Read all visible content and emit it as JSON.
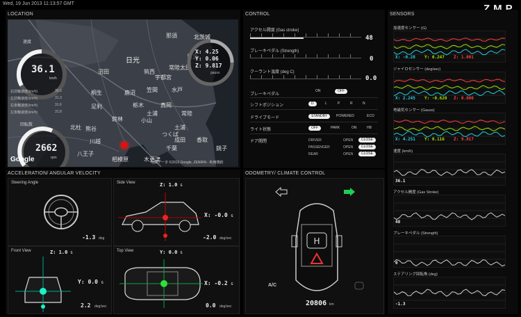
{
  "timestamp": "Wed, 19 Jun 2013 11:13:57 GMT",
  "brand": "ZMP",
  "location": {
    "title": "LOCATION",
    "map_labels": [
      "北茨城",
      "日光",
      "那須",
      "鹿沼",
      "宇都宮",
      "真岡",
      "栃木",
      "小山",
      "足利",
      "桐生",
      "館林",
      "熊谷",
      "つくば",
      "土浦",
      "川越",
      "八王子",
      "相模原",
      "千葉",
      "成田",
      "銚子",
      "香取",
      "木更津",
      "筑西",
      "常陸太田",
      "水戸",
      "笠間",
      "北杜",
      "沼田",
      "土浦",
      "常陸",
      "日立"
    ],
    "copyright": "地図データ ©2013 Google, ZENRIN - 利用規約",
    "google": "Google",
    "speed_label": "速度",
    "speed_value": "36.1",
    "speed_unit": "km/h",
    "wheel_speeds": [
      {
        "label": "右前輪速度(km/h)",
        "value": "36.5"
      },
      {
        "label": "左前輪速度(km/h)",
        "value": "31.3"
      },
      {
        "label": "右後輪速度(km/h)",
        "value": "31.6"
      },
      {
        "label": "左後輪速度(km/h)",
        "value": "31.8"
      }
    ],
    "rpm_label": "回転数",
    "rpm_value": "2662",
    "rpm_unit": "rpm",
    "compass": {
      "x": "4.25",
      "y": "0.06",
      "z": "9.817",
      "unit": "gauss"
    }
  },
  "control": {
    "title": "CONTROL",
    "sliders": [
      {
        "label": "アクセル開度 (Gas stroke)",
        "value": "48",
        "fill": 0.48
      },
      {
        "label": "ブレーキペダル (Strength)",
        "value": "0",
        "fill": 0.0
      },
      {
        "label": "クーラント温度 (deg C)",
        "value": "0.0",
        "fill": 0.0
      }
    ],
    "brake": {
      "label": "ブレーキペダル",
      "on": "ON",
      "off": "OFF"
    },
    "shift": {
      "label": "シフトポジション",
      "options": [
        "D",
        "L",
        "P",
        "R",
        "N"
      ]
    },
    "drive": {
      "label": "ドライブモード",
      "options": [
        "STANDBY",
        "POWERED",
        "ECO"
      ]
    },
    "lights": {
      "label": "ライト状態",
      "options": [
        "OFF",
        "PARK",
        "ON",
        "HB"
      ]
    },
    "doors": {
      "label": "ドア開閉",
      "rows": [
        {
          "name": "DRIVER",
          "open": "OPEN",
          "close": "CLOSE"
        },
        {
          "name": "PASSENGER",
          "open": "OPEN",
          "close": "CLOSE"
        },
        {
          "name": "REAR",
          "open": "OPEN",
          "close": "CLOSE"
        }
      ]
    }
  },
  "sensors": {
    "title": "SENSORS",
    "graphs": [
      {
        "label": "加速度センサー (G)",
        "x": "-0.28",
        "y": "0.247",
        "z": "1.001"
      },
      {
        "label": "ジャイロセンサー (deg/sec)",
        "x": "2.245",
        "y": "-0.620",
        "z": "0.000"
      },
      {
        "label": "地磁気センサー (Gauss)",
        "x": "4.251",
        "y": "0.116",
        "z": "9.817"
      },
      {
        "label": "速度 (km/h)",
        "value": "36.1"
      },
      {
        "label": "アクセル開度 (Gas Stroke)",
        "value": "48"
      },
      {
        "label": "ブレーキペダル (Strength)",
        "value": "0"
      },
      {
        "label": "ステアリング回転角 (deg)",
        "value": "-1.3"
      }
    ]
  },
  "accel": {
    "title": "ACCELERATION/ ANGULAR VELOCITY",
    "steering": {
      "title": "Steering Angle",
      "value": "-1.3",
      "unit": "deg"
    },
    "side": {
      "title": "Side View",
      "z": "1.0",
      "z_unit": "G",
      "x": "-0.0",
      "x_unit": "G",
      "rate": "-2.0",
      "rate_unit": "deg/sec"
    },
    "front": {
      "title": "Front View",
      "z": "1.0",
      "z_unit": "G",
      "y": "0.0",
      "y_unit": "G",
      "rate": "2.2",
      "rate_unit": "deg/sec"
    },
    "top": {
      "title": "Top View",
      "y": "0.0",
      "y_unit": "G",
      "x": "-0.2",
      "x_unit": "G",
      "rate": "0.0",
      "rate_unit": "deg/sec"
    }
  },
  "odometry": {
    "title": "ODOMETRY/ CLIMATE CONTROL",
    "ac": "A/C",
    "odo": "20806",
    "odo_unit": "km"
  }
}
